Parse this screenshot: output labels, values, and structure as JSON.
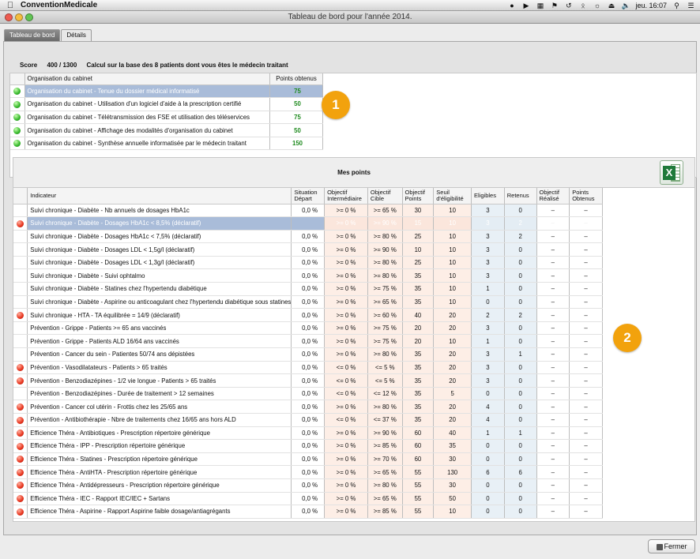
{
  "menubar": {
    "app_name": "ConventionMedicale",
    "clock": "jeu. 16:07"
  },
  "window": {
    "title": "Tableau de bord pour l'année 2014."
  },
  "tabs": [
    {
      "label": "Tableau de bord",
      "active": true
    },
    {
      "label": "Détails",
      "active": false
    }
  ],
  "score": {
    "label": "Score",
    "value": "400 / 1300",
    "description": "Calcul sur la base des 8  patients dont vous êtes le médecin traitant"
  },
  "organisation": {
    "headers": {
      "indicator": "Organisation du cabinet",
      "points": "Points obtenus"
    },
    "rows": [
      {
        "status": "green",
        "label": "Organisation du cabinet - Tenue du dossier médical informatisé",
        "points": "75",
        "state": "selected"
      },
      {
        "status": "green",
        "label": "Organisation du cabinet - Utilisation d'un logiciel d'aide à la prescription certifié",
        "points": "50",
        "state": ""
      },
      {
        "status": "green",
        "label": "Organisation du cabinet - Télétransmission des FSE et utilisation des téléservices",
        "points": "75",
        "state": ""
      },
      {
        "status": "green",
        "label": "Organisation du cabinet - Affichage des modalités d'organisation du cabinet",
        "points": "50",
        "state": ""
      },
      {
        "status": "green",
        "label": "Organisation du cabinet - Synthèse annuelle informatisée par le médecin traitant",
        "points": "150",
        "state": ""
      }
    ]
  },
  "mes_points": {
    "title": "Mes points",
    "export_icon": "excel-icon",
    "headers": {
      "indicator": "Indicateur",
      "situation": [
        "Situation",
        "Départ"
      ],
      "obj_inter": [
        "Objectif",
        "Intermédiaire"
      ],
      "obj_cible": [
        "Objectif",
        "Cible"
      ],
      "obj_points": [
        "Objectif",
        "Points"
      ],
      "seuil": [
        "Seuil",
        "d'éligibilité"
      ],
      "eligibles": "Eligibles",
      "retenus": "Retenus",
      "obj_realise": [
        "Objectif",
        "Réalisé"
      ],
      "points_obtenus": [
        "Points",
        "Obtenus"
      ]
    },
    "rows": [
      {
        "status": "",
        "label": "Suivi chronique - Diabète - Nb annuels de dosages HbA1c",
        "sd": "0,0 %",
        "oi": ">= 0 %",
        "oc": ">= 65 %",
        "op": "30",
        "se": "10",
        "el": "3",
        "re": "0",
        "orr": "–",
        "ob": "–",
        "state": ""
      },
      {
        "status": "red",
        "label": "Suivi chronique - Diabète - Dosages HbA1c < 8,5% (déclaratif)",
        "sd": "",
        "oi": ">= 0 %",
        "oc": ">= 90 %",
        "op": "15",
        "se": "10",
        "el": "3",
        "re": "2",
        "orr": "–",
        "ob": "–",
        "state": "selected"
      },
      {
        "status": "",
        "label": "Suivi chronique - Diabète - Dosages HbA1c < 7,5% (déclaratif)",
        "sd": "0,0 %",
        "oi": ">= 0 %",
        "oc": ">= 80 %",
        "op": "25",
        "se": "10",
        "el": "3",
        "re": "2",
        "orr": "–",
        "ob": "–",
        "state": ""
      },
      {
        "status": "",
        "label": "Suivi chronique - Diabète - Dosages LDL < 1,5g/l (déclaratif)",
        "sd": "0,0 %",
        "oi": ">= 0 %",
        "oc": ">= 90 %",
        "op": "10",
        "se": "10",
        "el": "3",
        "re": "0",
        "orr": "–",
        "ob": "–",
        "state": ""
      },
      {
        "status": "",
        "label": "Suivi chronique - Diabète - Dosages LDL < 1,3g/l (déclaratif)",
        "sd": "0,0 %",
        "oi": ">= 0 %",
        "oc": ">= 80 %",
        "op": "25",
        "se": "10",
        "el": "3",
        "re": "0",
        "orr": "–",
        "ob": "–",
        "state": ""
      },
      {
        "status": "",
        "label": "Suivi chronique - Diabète - Suivi ophtalmo",
        "sd": "0,0 %",
        "oi": ">= 0 %",
        "oc": ">= 80 %",
        "op": "35",
        "se": "10",
        "el": "3",
        "re": "0",
        "orr": "–",
        "ob": "–",
        "state": ""
      },
      {
        "status": "",
        "label": "Suivi chronique - Diabète - Statines chez l'hypertendu diabétique",
        "sd": "0,0 %",
        "oi": ">= 0 %",
        "oc": ">= 75 %",
        "op": "35",
        "se": "10",
        "el": "1",
        "re": "0",
        "orr": "–",
        "ob": "–",
        "state": ""
      },
      {
        "status": "",
        "label": "Suivi chronique - Diabète - Aspirine ou anticoagulant chez l'hypertendu diabétique sous statines",
        "sd": "0,0 %",
        "oi": ">= 0 %",
        "oc": ">= 65 %",
        "op": "35",
        "se": "10",
        "el": "0",
        "re": "0",
        "orr": "–",
        "ob": "–",
        "state": ""
      },
      {
        "status": "red",
        "label": "Suivi chronique - HTA - TA équilibrée = 14/9 (déclaratif)",
        "sd": "0,0 %",
        "oi": ">= 0 %",
        "oc": ">= 60 %",
        "op": "40",
        "se": "20",
        "el": "2",
        "re": "2",
        "orr": "–",
        "ob": "–",
        "state": ""
      },
      {
        "status": "",
        "label": "Prévention - Grippe - Patients >= 65 ans vaccinés",
        "sd": "0,0 %",
        "oi": ">= 0 %",
        "oc": ">= 75 %",
        "op": "20",
        "se": "20",
        "el": "3",
        "re": "0",
        "orr": "–",
        "ob": "–",
        "state": ""
      },
      {
        "status": "",
        "label": "Prévention - Grippe - Patients ALD 16/64 ans vaccinés",
        "sd": "0,0 %",
        "oi": ">= 0 %",
        "oc": ">= 75 %",
        "op": "20",
        "se": "10",
        "el": "1",
        "re": "0",
        "orr": "–",
        "ob": "–",
        "state": ""
      },
      {
        "status": "",
        "label": "Prévention - Cancer du sein - Patientes 50/74 ans dépistées",
        "sd": "0,0 %",
        "oi": ">= 0 %",
        "oc": ">= 80 %",
        "op": "35",
        "se": "20",
        "el": "3",
        "re": "1",
        "orr": "–",
        "ob": "–",
        "state": ""
      },
      {
        "status": "red",
        "label": "Prévention - Vasodilatateurs - Patients > 65 traités",
        "sd": "0,0 %",
        "oi": "<= 0 %",
        "oc": "<= 5 %",
        "op": "35",
        "se": "20",
        "el": "3",
        "re": "0",
        "orr": "–",
        "ob": "–",
        "state": ""
      },
      {
        "status": "red",
        "label": "Prévention - Benzodiazépines - 1/2 vie longue - Patients > 65 traités",
        "sd": "0,0 %",
        "oi": "<= 0 %",
        "oc": "<= 5 %",
        "op": "35",
        "se": "20",
        "el": "3",
        "re": "0",
        "orr": "–",
        "ob": "–",
        "state": ""
      },
      {
        "status": "",
        "label": "Prévention - Benzodiazépines - Durée de traitement > 12 semaines",
        "sd": "0,0 %",
        "oi": "<= 0 %",
        "oc": "<= 12 %",
        "op": "35",
        "se": "5",
        "el": "0",
        "re": "0",
        "orr": "–",
        "ob": "–",
        "state": ""
      },
      {
        "status": "red",
        "label": "Prévention - Cancer col utérin - Frottis chez les 25/65 ans",
        "sd": "0,0 %",
        "oi": ">= 0 %",
        "oc": ">= 80 %",
        "op": "35",
        "se": "20",
        "el": "4",
        "re": "0",
        "orr": "–",
        "ob": "–",
        "state": ""
      },
      {
        "status": "red",
        "label": "Prévention - Antibiothérapie - Nbre de traitements chez 16/65 ans hors ALD",
        "sd": "0,0 %",
        "oi": "<= 0 %",
        "oc": "<= 37 %",
        "op": "35",
        "se": "20",
        "el": "4",
        "re": "0",
        "orr": "–",
        "ob": "–",
        "state": ""
      },
      {
        "status": "red",
        "label": "Efficience Théra - Antibiotiques - Prescription répertoire générique",
        "sd": "0,0 %",
        "oi": ">= 0 %",
        "oc": ">= 90 %",
        "op": "60",
        "se": "40",
        "el": "1",
        "re": "1",
        "orr": "–",
        "ob": "–",
        "state": ""
      },
      {
        "status": "red",
        "label": "Efficience Théra - IPP - Prescription répertoire générique",
        "sd": "0,0 %",
        "oi": ">= 0 %",
        "oc": ">= 85 %",
        "op": "60",
        "se": "35",
        "el": "0",
        "re": "0",
        "orr": "–",
        "ob": "–",
        "state": ""
      },
      {
        "status": "red",
        "label": "Efficience Théra - Statines - Prescription répertoire générique",
        "sd": "0,0 %",
        "oi": ">= 0 %",
        "oc": ">= 70 %",
        "op": "60",
        "se": "30",
        "el": "0",
        "re": "0",
        "orr": "–",
        "ob": "–",
        "state": ""
      },
      {
        "status": "red",
        "label": "Efficience Théra - AntiHTA - Prescription répertoire générique",
        "sd": "0,0 %",
        "oi": ">= 0 %",
        "oc": ">= 65 %",
        "op": "55",
        "se": "130",
        "el": "6",
        "re": "6",
        "orr": "–",
        "ob": "–",
        "state": ""
      },
      {
        "status": "red",
        "label": "Efficience Théra - Antidépresseurs - Prescription répertoire générique",
        "sd": "0,0 %",
        "oi": ">= 0 %",
        "oc": ">= 80 %",
        "op": "55",
        "se": "30",
        "el": "0",
        "re": "0",
        "orr": "–",
        "ob": "–",
        "state": ""
      },
      {
        "status": "red",
        "label": "Efficience Théra - IEC - Rapport IEC/IEC + Sartans",
        "sd": "0,0 %",
        "oi": ">= 0 %",
        "oc": ">= 65 %",
        "op": "55",
        "se": "50",
        "el": "0",
        "re": "0",
        "orr": "–",
        "ob": "–",
        "state": ""
      },
      {
        "status": "red",
        "label": "Efficience Théra - Aspirine - Rapport Aspirine faible dosage/antiagrégants",
        "sd": "0,0 %",
        "oi": ">= 0 %",
        "oc": ">= 85 %",
        "op": "55",
        "se": "10",
        "el": "0",
        "re": "0",
        "orr": "–",
        "ob": "–",
        "state": ""
      }
    ]
  },
  "badges": [
    "1",
    "2"
  ],
  "close_button": {
    "label": "Fermer"
  },
  "colors": {
    "badge": "#f2a20d",
    "selection": "#a9bcd9",
    "green_points": "#1e8a1e"
  }
}
